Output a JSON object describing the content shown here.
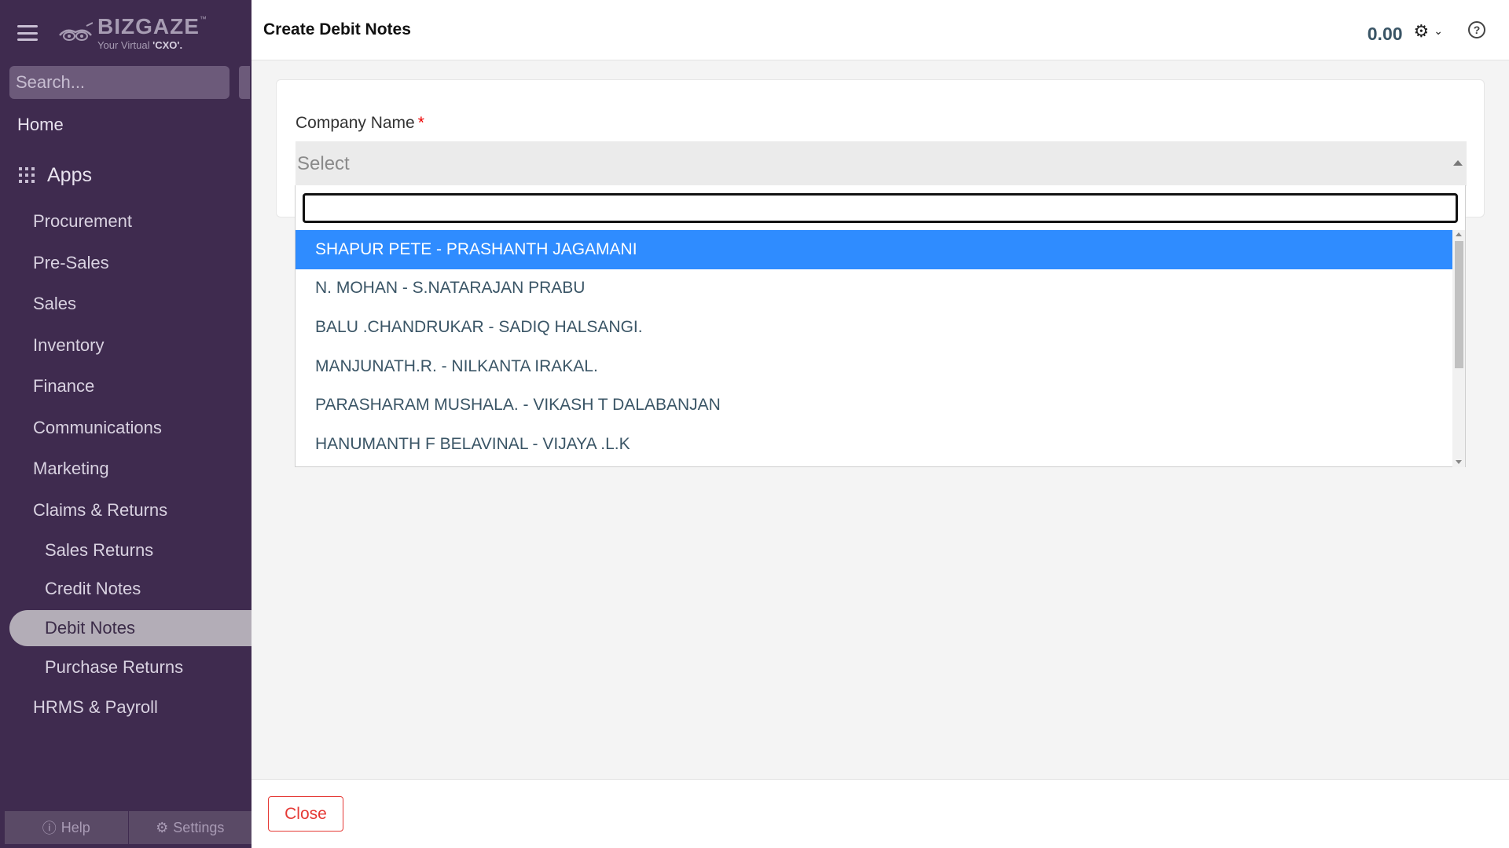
{
  "brand": {
    "name": "BIZGAZE",
    "tm": "™",
    "tagline_prefix": "Your Virtual ",
    "tagline_highlight": "'CXO'."
  },
  "sidebar": {
    "search_placeholder": "Search...",
    "home": "Home",
    "apps": "Apps",
    "items": [
      {
        "label": "Procurement"
      },
      {
        "label": "Pre-Sales"
      },
      {
        "label": "Sales"
      },
      {
        "label": "Inventory"
      },
      {
        "label": "Finance"
      },
      {
        "label": "Communications"
      },
      {
        "label": "Marketing"
      },
      {
        "label": "Claims & Returns"
      }
    ],
    "subitems": [
      {
        "label": "Sales Returns"
      },
      {
        "label": "Credit Notes"
      },
      {
        "label": "Debit Notes",
        "active": true
      },
      {
        "label": "Purchase Returns"
      }
    ],
    "last_item": "HRMS & Payroll",
    "footer": {
      "help": "Help",
      "settings": "Settings"
    }
  },
  "header": {
    "title": "Create Debit Notes",
    "amount": "0.00"
  },
  "form": {
    "company_label": "Company Name",
    "required_mark": "*",
    "select_placeholder": "Select"
  },
  "dropdown": {
    "search_value": "",
    "options": [
      "SHAPUR PETE - PRASHANTH JAGAMANI",
      "N. MOHAN - S.NATARAJAN PRABU",
      "BALU .CHANDRUKAR - SADIQ HALSANGI.",
      "MANJUNATH.R. - NILKANTA IRAKAL.",
      "PARASHARAM MUSHALA. - VIKASH T DALABANJAN",
      "HANUMANTH F BELAVINAL - VIJAYA .L.K"
    ],
    "highlight_index": 0
  },
  "footer": {
    "close_label": "Close"
  },
  "colors": {
    "sidebar_bg": "#3f2b4f",
    "highlight": "#2f8cff",
    "close_red": "#e53935"
  }
}
